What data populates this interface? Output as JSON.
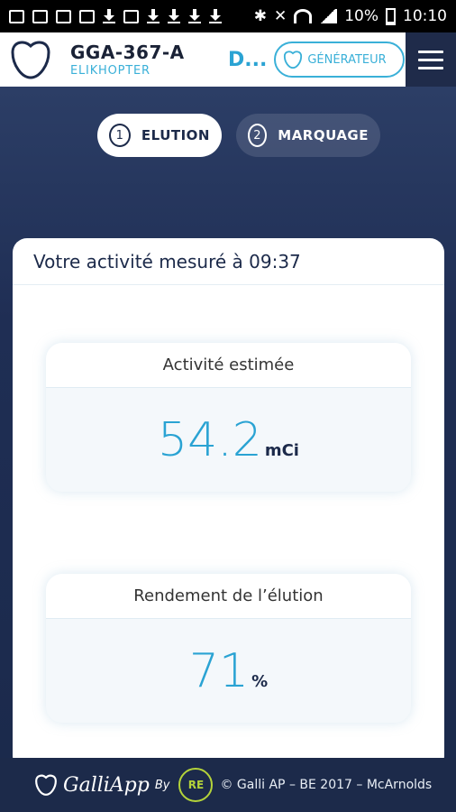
{
  "status_bar": {
    "battery_text": "10%",
    "time": "10:10"
  },
  "header": {
    "title": "GGA-367-A",
    "subtitle": "ELIKHOPTER",
    "truncated_label": "D...",
    "generator_button": "GÉNÉRATEUR",
    "menu_icon": "hamburger-icon",
    "accent_color": "#3ab0d8"
  },
  "steps": [
    {
      "number": "1",
      "label": "ELUTION",
      "active": true
    },
    {
      "number": "2",
      "label": "MARQUAGE",
      "active": false
    }
  ],
  "card": {
    "heading": "Votre activité mesuré à 09:37",
    "panels": [
      {
        "label": "Activité estimée",
        "value": "54.2",
        "unit": "mCi"
      },
      {
        "label": "Rendement de l’élution",
        "value": "71",
        "unit": "%"
      }
    ]
  },
  "footer": {
    "brand": "GalliApp",
    "by": "By",
    "partner_logo": "RE",
    "copyright": "© Galli AP – BE 2017 – McArnolds"
  }
}
